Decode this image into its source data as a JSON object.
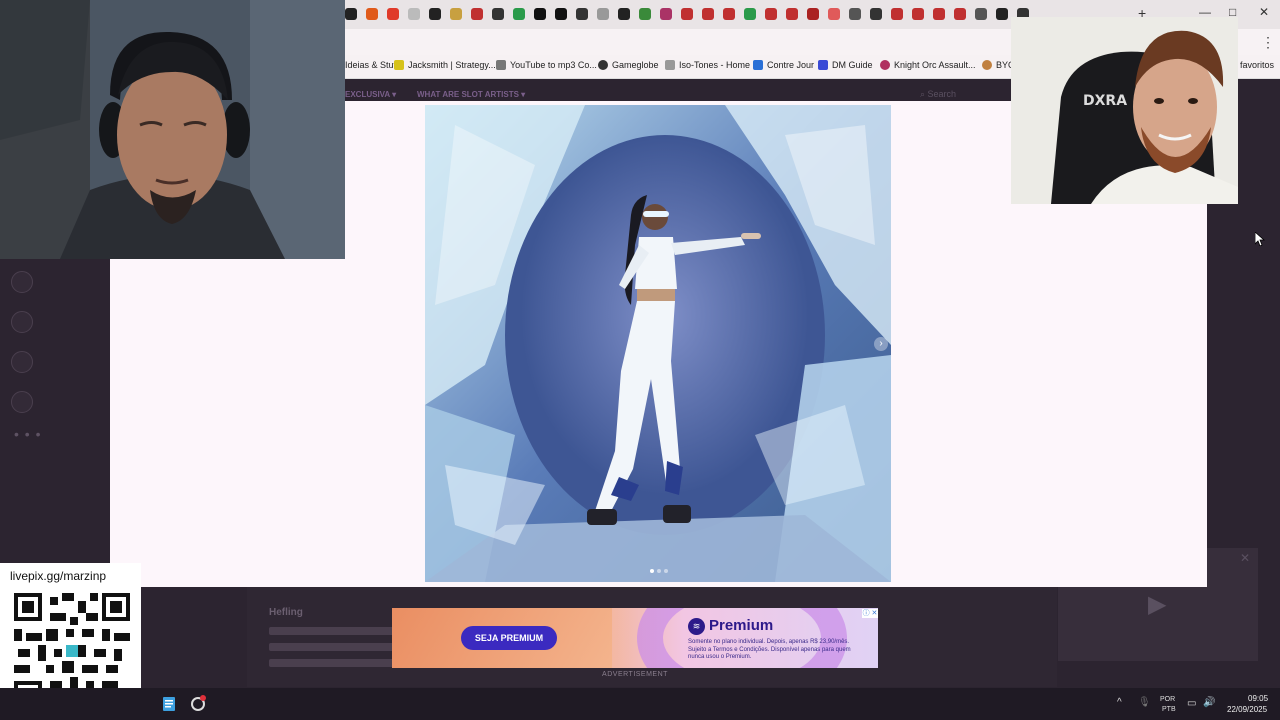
{
  "browser": {
    "bookmarks": [
      {
        "label": "Ideias & Stuff",
        "icon": "folder-icon",
        "color": "#f2c230"
      },
      {
        "label": "Jacksmith | Strategy...",
        "icon": "shield-icon",
        "color": "#d6c21a"
      },
      {
        "label": "YouTube to mp3 Co...",
        "icon": "sync-icon",
        "color": "#666666"
      },
      {
        "label": "Gameglobe",
        "icon": "globe-icon",
        "color": "#333333"
      },
      {
        "label": "Iso-Tones - Home",
        "icon": "page-icon",
        "color": "#888888"
      },
      {
        "label": "Contre Jour",
        "icon": "link-icon",
        "color": "#2a6fd6"
      },
      {
        "label": "DM Guide",
        "icon": "star-icon",
        "color": "#3a4ad6"
      },
      {
        "label": "Knight Orc Assault...",
        "icon": "orc-icon",
        "color": "#b03060"
      },
      {
        "label": "BYO",
        "icon": "cookie-icon",
        "color": "#c08040"
      }
    ],
    "other_favorites": "favoritos",
    "new_tab_symbol": "+",
    "menu_symbol": "⋮",
    "window_controls": [
      "—",
      "□",
      "✕"
    ]
  },
  "page": {
    "nav": [
      "EXCLUSIVA ▾",
      "WHAT ARE SLOT ARTISTS ▾"
    ],
    "search_placeholder": "Search",
    "article_keyword": "Hefling",
    "rail_more": "• • •",
    "lightbox": {
      "next_symbol": "›",
      "slide_count": 3,
      "active_slide": 1
    }
  },
  "ad": {
    "cta": "SEJA PREMIUM",
    "brand": "Premium",
    "fine_print": "Somente no plano individual. Depois, apenas R$ 23,90/mês. Sujeito a Termos e Condições. Disponível apenas para quem nunca usou o Premium.",
    "info_symbol": "ⓘ ✕",
    "caption": "ADVERTISEMENT"
  },
  "donation": {
    "url": "livepix.gg/marzinp"
  },
  "taskbar": {
    "tray_chevron": "^",
    "lang_top": "POR",
    "lang_bottom": "PTB",
    "time": "09:05",
    "date": "22/09/2025"
  }
}
